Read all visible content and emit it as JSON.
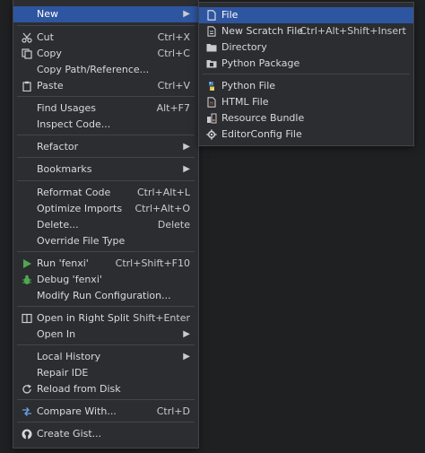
{
  "menu": {
    "new": "New",
    "cut": {
      "label": "Cut",
      "shortcut": "Ctrl+X"
    },
    "copy": {
      "label": "Copy",
      "shortcut": "Ctrl+C"
    },
    "copy_path": "Copy Path/Reference...",
    "paste": {
      "label": "Paste",
      "shortcut": "Ctrl+V"
    },
    "find_usages": {
      "label": "Find Usages",
      "shortcut": "Alt+F7"
    },
    "inspect_code": "Inspect Code...",
    "refactor": "Refactor",
    "bookmarks": "Bookmarks",
    "reformat": {
      "label": "Reformat Code",
      "shortcut": "Ctrl+Alt+L"
    },
    "optimize": {
      "label": "Optimize Imports",
      "shortcut": "Ctrl+Alt+O"
    },
    "delete": {
      "label": "Delete...",
      "shortcut": "Delete"
    },
    "override_type": "Override File Type",
    "run": {
      "label": "Run 'fenxi'",
      "shortcut": "Ctrl+Shift+F10"
    },
    "debug": "Debug 'fenxi'",
    "modify_run": "Modify Run Configuration...",
    "open_split": {
      "label": "Open in Right Split",
      "shortcut": "Shift+Enter"
    },
    "open_in": "Open In",
    "local_history": "Local History",
    "repair_ide": "Repair IDE",
    "reload": "Reload from Disk",
    "compare": {
      "label": "Compare With...",
      "shortcut": "Ctrl+D"
    },
    "create_gist": "Create Gist..."
  },
  "submenu": {
    "file": "File",
    "scratch": {
      "label": "New Scratch File",
      "shortcut": "Ctrl+Alt+Shift+Insert"
    },
    "directory": "Directory",
    "python_package": "Python Package",
    "python_file": "Python File",
    "html_file": "HTML File",
    "resource_bundle": "Resource Bundle",
    "editorconfig": "EditorConfig File"
  },
  "icons": {
    "cut": "scissors-icon",
    "copy": "copy-icon",
    "paste": "clipboard-icon",
    "run": "play-icon",
    "debug": "bug-icon",
    "split": "split-icon",
    "reload": "reload-icon",
    "compare": "compare-icon",
    "gist": "github-icon"
  },
  "colors": {
    "selection": "#2e55a0",
    "run_green": "#4fa84f",
    "menu_bg": "#2b2d30"
  }
}
